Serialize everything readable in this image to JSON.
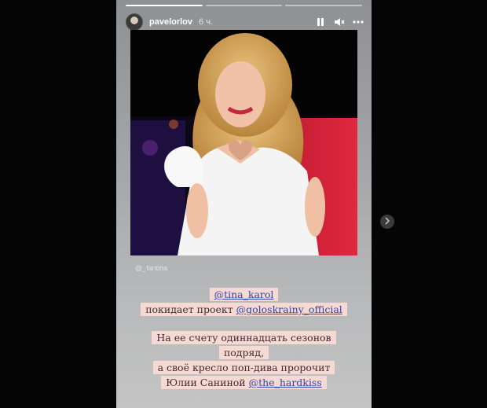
{
  "story": {
    "progress": [
      1.0,
      0.0,
      0.0
    ],
    "user": {
      "username": "pavelorlov",
      "time_ago": "6 ч."
    },
    "icons": {
      "avatar": "profile-avatar",
      "pause": "pause-icon",
      "mute": "speaker-muted-icon",
      "more": "more-horizontal-icon"
    },
    "photo_credit": "@_fantina",
    "caption1": {
      "mention": "@tina_karol",
      "text": "покидает проект ",
      "mention2": "@goloskrainy_official"
    },
    "caption2": {
      "line1": "На ее счету одиннадцать сезонов",
      "line2": "подряд,",
      "line3": "а своё кресло поп-дива пророчит",
      "line4_text": "Юлии Саниной ",
      "line4_mention": "@the_hardkiss"
    }
  },
  "navigation": {
    "next_icon": "chevron-right-icon"
  },
  "colors": {
    "caption_bg": "#f7d9d3",
    "mention": "#2d46a8",
    "background": "#050505"
  }
}
